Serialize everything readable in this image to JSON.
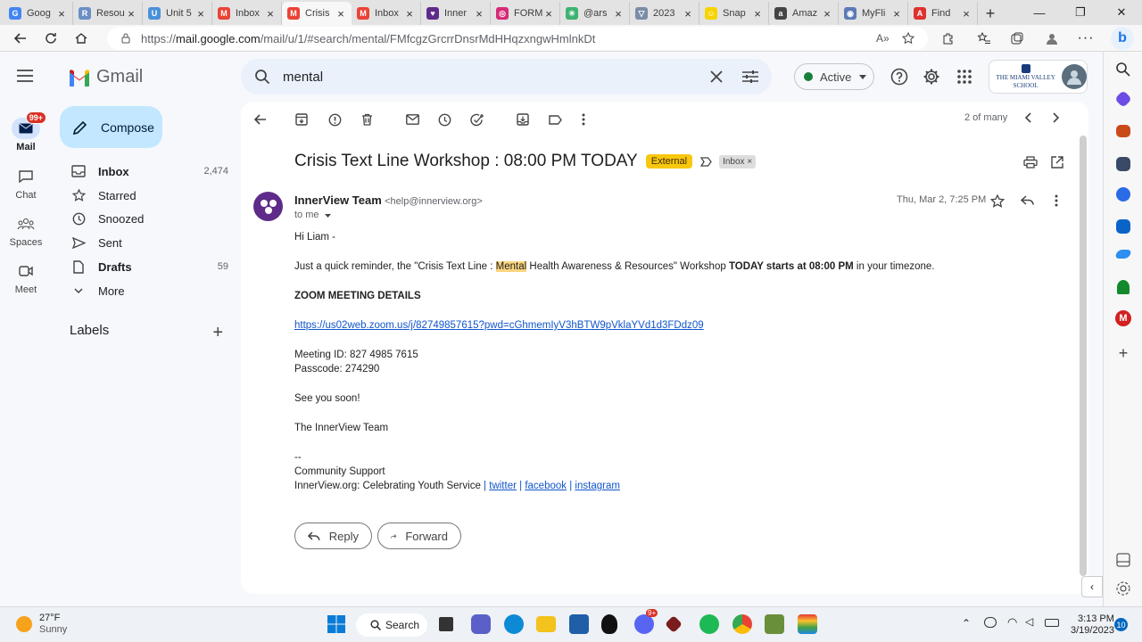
{
  "browser": {
    "tabs": [
      {
        "label": "Goog",
        "color": "#4285f4",
        "glyph": "G"
      },
      {
        "label": "Resou",
        "color": "#6a8ec5",
        "glyph": "R"
      },
      {
        "label": "Unit 5",
        "color": "#4a90d9",
        "glyph": "U"
      },
      {
        "label": "Inbox",
        "color": "#ea4335",
        "glyph": "M"
      },
      {
        "label": "Crisis",
        "color": "#ea4335",
        "glyph": "M",
        "active": true
      },
      {
        "label": "Inbox",
        "color": "#ea4335",
        "glyph": "M"
      },
      {
        "label": "Inner",
        "color": "#5f2b8a",
        "glyph": "♥"
      },
      {
        "label": "FORM",
        "color": "#d62976",
        "glyph": "◎"
      },
      {
        "label": "@ars",
        "color": "#3cb371",
        "glyph": "✳"
      },
      {
        "label": "2023",
        "color": "#7a8ca8",
        "glyph": "▽"
      },
      {
        "label": "Snap",
        "color": "#f7d400",
        "glyph": "☺"
      },
      {
        "label": "Amaz",
        "color": "#444444",
        "glyph": "a"
      },
      {
        "label": "MyFli",
        "color": "#5b7bb5",
        "glyph": "◉"
      },
      {
        "label": "Find",
        "color": "#e03030",
        "glyph": "A"
      }
    ],
    "new_tab": "+",
    "window_controls": [
      "—",
      "❐",
      "✕"
    ],
    "url_prefix": "https://",
    "url_host": "mail.google.com",
    "url_path": "/mail/u/1/#search/mental/FMfcgzGrcrrDnsrMdHHqzxngwHmlnkDt"
  },
  "rail": {
    "mail_label": "Mail",
    "mail_badge": "99+",
    "chat_label": "Chat",
    "spaces_label": "Spaces",
    "meet_label": "Meet"
  },
  "header": {
    "logo_text": "Gmail",
    "search_query": "mental",
    "status_label": "Active",
    "school_name": "The Miami Valley School"
  },
  "nav": {
    "compose_label": "Compose",
    "items": [
      {
        "label": "Inbox",
        "count": "2,474",
        "bold": true
      },
      {
        "label": "Starred",
        "count": ""
      },
      {
        "label": "Snoozed",
        "count": ""
      },
      {
        "label": "Sent",
        "count": ""
      },
      {
        "label": "Drafts",
        "count": "59",
        "bold": true
      },
      {
        "label": "More",
        "count": ""
      }
    ],
    "labels_heading": "Labels",
    "labels_add": "+"
  },
  "message": {
    "pager": "2 of many",
    "subject": "Crisis Text Line Workshop : 08:00 PM TODAY",
    "external_label": "External",
    "inbox_chip": "Inbox ×",
    "sender_name": "InnerView Team",
    "sender_email": "<help@innerview.org>",
    "to_line": "to me",
    "date": "Thu, Mar 2, 7:25 PM",
    "greeting": "Hi Liam -",
    "reminder_pre": "Just a quick reminder, the \"Crisis Text Line : ",
    "reminder_highlight": "Mental",
    "reminder_mid": " Health Awareness & Resources\" Workshop ",
    "reminder_bold": "TODAY starts at 08:00 PM",
    "reminder_post": " in your timezone.",
    "zoom_heading": "ZOOM MEETING DETAILS",
    "zoom_link": "https://us02web.zoom.us/j/82749857615?pwd=cGhmemIyV3hBTW9pVklaYVd1d3FDdz09",
    "meeting_id": "Meeting ID: 827 4985 7615",
    "passcode": "Passcode: 274290",
    "see_you": "See you soon!",
    "signoff": "The InnerView Team",
    "dashes": "--",
    "community": "Community Support",
    "footer_text": "InnerView.org: Celebrating Youth Service ",
    "footer_sep": "|",
    "link_twitter": "twitter",
    "link_facebook": "facebook",
    "link_instagram": "instagram",
    "reply_label": "Reply",
    "forward_label": "Forward"
  },
  "taskbar": {
    "temperature": "27°F",
    "condition": "Sunny",
    "search_label": "Search",
    "time": "3:13 PM",
    "date": "3/19/2023",
    "notifications": "10",
    "discord_badge": "9+"
  },
  "colors": {
    "gmail_red": "#ea4335",
    "compose_bg": "#c2e7ff",
    "external_badge": "#f9c80e",
    "highlight": "#fcd581",
    "link": "#1155cc"
  }
}
